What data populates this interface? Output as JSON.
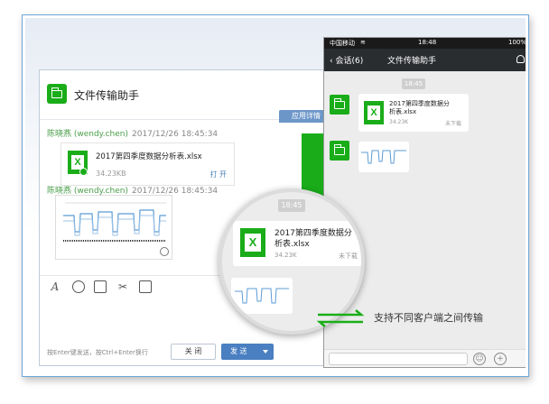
{
  "desktop": {
    "title": "文件传输助手",
    "app_detail_tab": "应用详情",
    "messages": [
      {
        "sender": "陈晓燕 (wendy.chen)",
        "time": "2017/12/26 18:45:34"
      },
      {
        "sender": "陈晓燕 (wendy.chen)",
        "time": "2017/12/26 18:45:34"
      }
    ],
    "file": {
      "name": "2017第四季度数据分析表.xlsx",
      "size": "34.23KB",
      "action": "打 开",
      "icon_letter": "X"
    },
    "hint": "按Enter键发送，按Ctrl+Enter换行",
    "close_button": "关 闭",
    "send_button": "发 送",
    "toolbar_icons": [
      "font-icon",
      "emoji-icon",
      "image-icon",
      "scissors-icon",
      "folder-icon"
    ]
  },
  "phone": {
    "carrier": "中国移动",
    "wifi": "wifi-icon",
    "clock": "18:48",
    "battery": "100%",
    "back_label": "会话(6)",
    "title": "文件传输助手",
    "time_pill": "18:45",
    "file": {
      "name_line1": "2017第四季度数据分",
      "name_line2": "析表.xlsx",
      "size": "34.23K",
      "status": "未下载"
    }
  },
  "magnifier": {
    "time_pill": "18:45",
    "file": {
      "name_line1": "2017第四季度数据分",
      "name_line2": "析表.xlsx",
      "size": "34.23K",
      "status": "未下载"
    }
  },
  "caption": "支持不同客户端之间传输",
  "colors": {
    "accent_green": "#1aad19",
    "link_blue": "#4a7fb5",
    "send_blue": "#4a7fc1",
    "nav_dark": "#2a2d30"
  }
}
